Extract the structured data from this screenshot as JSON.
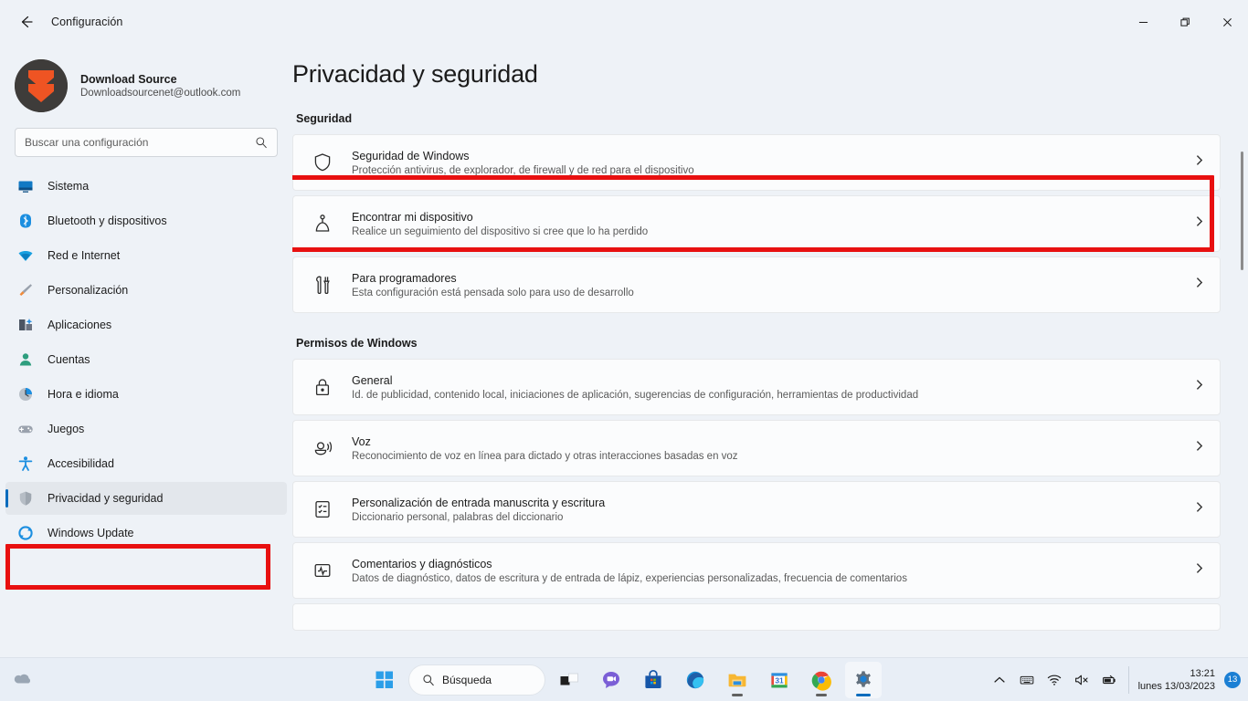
{
  "window": {
    "app_title": "Configuración",
    "back_icon": "arrow-left-icon",
    "minimize_label": "—",
    "maximize_label": "▢",
    "close_label": "✕"
  },
  "account": {
    "name": "Download Source",
    "email": "Downloadsourcenet@outlook.com",
    "avatar_bg": "#3e3c3a",
    "avatar_accent": "#ef5423"
  },
  "search": {
    "placeholder": "Buscar una configuración",
    "value": "",
    "icon": "search-icon"
  },
  "sidebar": {
    "items": [
      {
        "label": "Sistema",
        "icon": "monitor-icon",
        "selected": false
      },
      {
        "label": "Bluetooth y dispositivos",
        "icon": "bluetooth-icon",
        "selected": false
      },
      {
        "label": "Red e Internet",
        "icon": "wifi-icon",
        "selected": false
      },
      {
        "label": "Personalización",
        "icon": "brush-icon",
        "selected": false
      },
      {
        "label": "Aplicaciones",
        "icon": "apps-icon",
        "selected": false
      },
      {
        "label": "Cuentas",
        "icon": "person-icon",
        "selected": false
      },
      {
        "label": "Hora e idioma",
        "icon": "clock-icon",
        "selected": false
      },
      {
        "label": "Juegos",
        "icon": "gamepad-icon",
        "selected": false
      },
      {
        "label": "Accesibilidad",
        "icon": "accessibility-icon",
        "selected": false
      },
      {
        "label": "Privacidad y seguridad",
        "icon": "shield-icon",
        "selected": true
      },
      {
        "label": "Windows Update",
        "icon": "update-icon",
        "selected": false
      }
    ]
  },
  "main": {
    "page_title": "Privacidad y seguridad",
    "sections": [
      {
        "label": "Seguridad",
        "cards": [
          {
            "title": "Seguridad de Windows",
            "subtitle": "Protección antivirus, de explorador, de firewall y de red para el dispositivo",
            "icon": "shield-outline-icon",
            "highlighted": true
          },
          {
            "title": "Encontrar mi dispositivo",
            "subtitle": "Realice un seguimiento del dispositivo si cree que lo ha perdido",
            "icon": "locator-pin-icon",
            "highlighted": false
          },
          {
            "title": "Para programadores",
            "subtitle": "Esta configuración está pensada solo para uso de desarrollo",
            "icon": "tools-icon",
            "highlighted": false
          }
        ]
      },
      {
        "label": "Permisos de Windows",
        "cards": [
          {
            "title": "General",
            "subtitle": "Id. de publicidad, contenido local, iniciaciones de aplicación, sugerencias de configuración, herramientas de productividad",
            "icon": "lock-icon",
            "highlighted": false
          },
          {
            "title": "Voz",
            "subtitle": "Reconocimiento de voz en línea para dictado y otras interacciones basadas en voz",
            "icon": "speech-icon",
            "highlighted": false
          },
          {
            "title": "Personalización de entrada manuscrita y escritura",
            "subtitle": "Diccionario personal, palabras del diccionario",
            "icon": "handwriting-icon",
            "highlighted": false
          },
          {
            "title": "Comentarios y diagnósticos",
            "subtitle": "Datos de diagnóstico, datos de escritura y de entrada de lápiz, experiencias personalizadas, frecuencia de comentarios",
            "icon": "diagnostics-icon",
            "highlighted": false
          }
        ]
      }
    ],
    "chevron_icon": "chevron-right-icon"
  },
  "annotations": {
    "color": "#e81010",
    "boxes": [
      "windows-security-card",
      "privacy-security-sidebar-item"
    ]
  },
  "taskbar": {
    "widget_icon": "weather-widget-icon",
    "search_label": "Búsqueda",
    "search_icon": "search-icon",
    "buttons": [
      {
        "name": "start",
        "label": "Inicio"
      },
      {
        "name": "search",
        "label": "Búsqueda"
      },
      {
        "name": "task-view",
        "label": "Vista de tareas"
      },
      {
        "name": "chat",
        "label": "Chat"
      },
      {
        "name": "store",
        "label": "Microsoft Store"
      },
      {
        "name": "edge",
        "label": "Microsoft Edge"
      },
      {
        "name": "file-explorer",
        "label": "Explorador de archivos"
      },
      {
        "name": "calendar",
        "label": "Calendario"
      },
      {
        "name": "chrome",
        "label": "Google Chrome"
      },
      {
        "name": "settings",
        "label": "Configuración"
      }
    ],
    "calendar_day": "31",
    "tray": {
      "chevron_icon": "chevron-up-icon",
      "keyboard_icon": "keyboard-icon",
      "wifi_icon": "wifi-icon",
      "volume_icon": "volume-muted-icon",
      "battery_icon": "battery-icon",
      "time": "13:21",
      "date": "lunes 13/03/2023",
      "notification_count": "13"
    }
  }
}
